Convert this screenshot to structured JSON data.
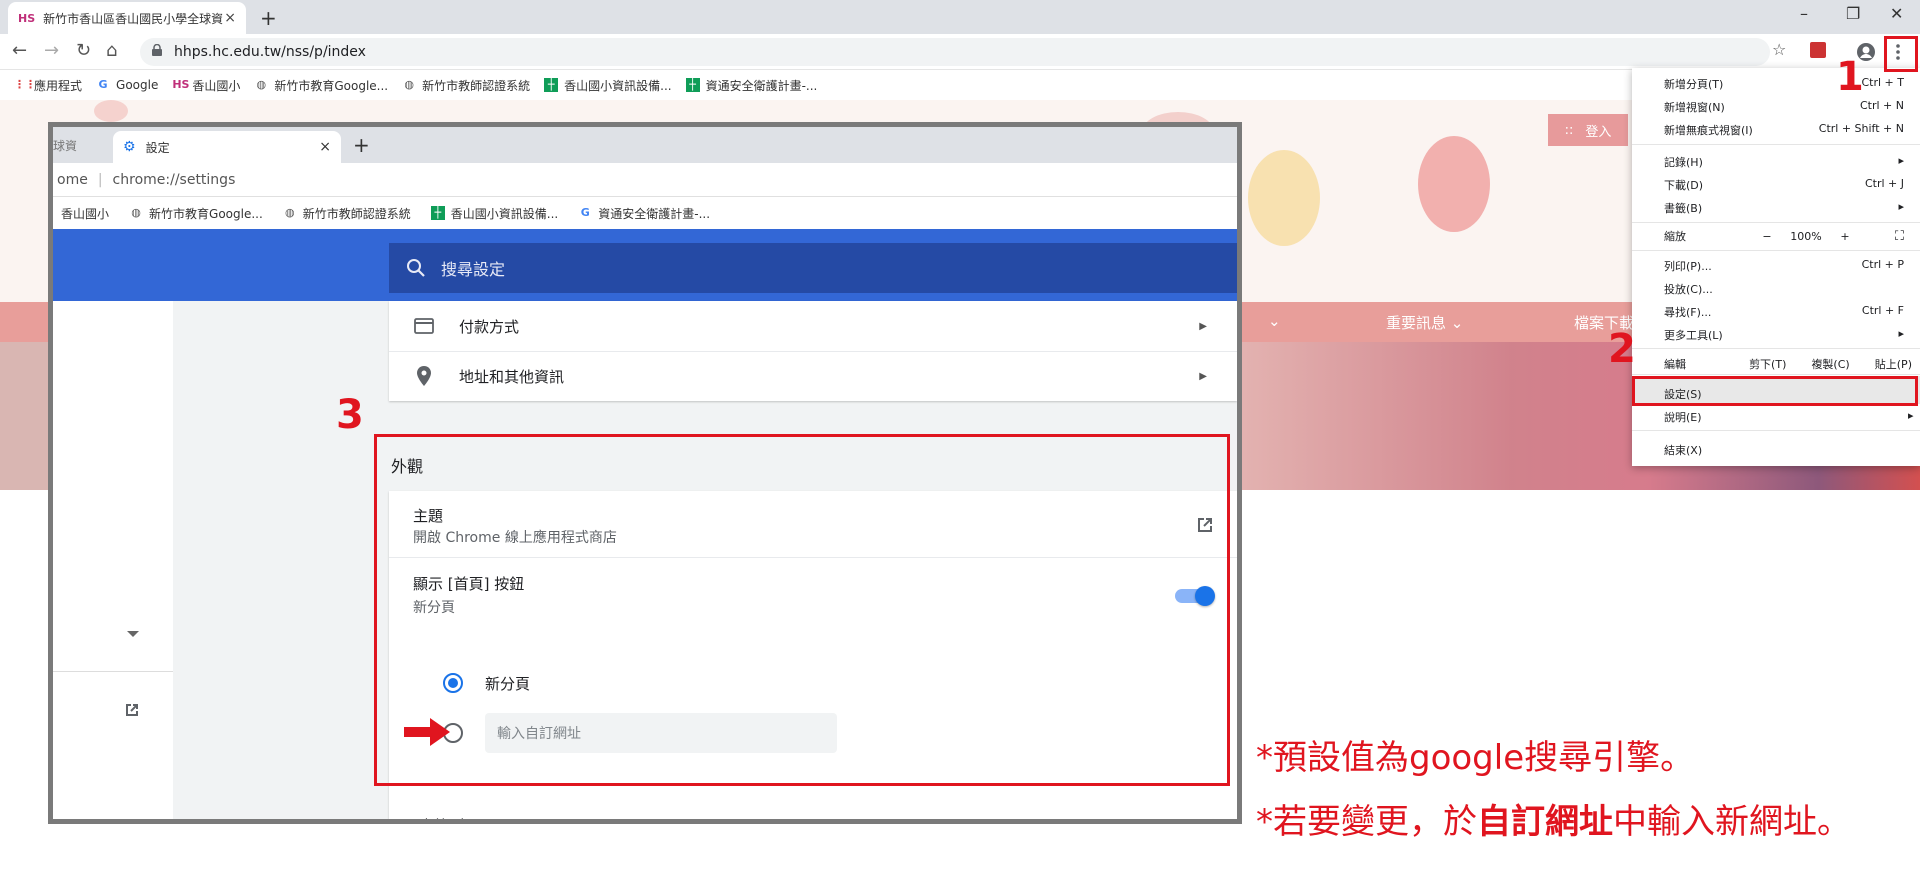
{
  "browser": {
    "tab": {
      "favicon": "HS",
      "title": "新竹市香山區香山國民小學全球資",
      "close": "×"
    },
    "new_tab": "+",
    "window_controls": [
      "–",
      "❐",
      "✕"
    ],
    "url": "hhps.hc.edu.tw/nss/p/index",
    "bookmarks": [
      {
        "icon": "apps-grid-icon",
        "label": "應用程式"
      },
      {
        "icon": "google-icon",
        "label": "Google"
      },
      {
        "icon": "hs-icon",
        "label": "香山國小"
      },
      {
        "icon": "globe-icon",
        "label": "新竹市教育Google..."
      },
      {
        "icon": "globe-icon",
        "label": "新竹市教師認證系統"
      },
      {
        "icon": "sheets-icon",
        "label": "香山國小資訊設備..."
      },
      {
        "icon": "sheets-icon",
        "label": "資通安全衛護計畫-..."
      }
    ]
  },
  "site": {
    "login_label": "登入",
    "login_prefix": "::",
    "nav": [
      "重要訊息 ⌄",
      "檔案下載"
    ],
    "nav_partial": "⌄"
  },
  "menu": {
    "items_top": [
      {
        "label": "新增分頁(T)",
        "shortcut": "Ctrl + T"
      },
      {
        "label": "新增視窗(N)",
        "shortcut": "Ctrl + N"
      },
      {
        "label": "新增無痕式視窗(I)",
        "shortcut": "Ctrl + Shift + N"
      }
    ],
    "items_mid": [
      {
        "label": "記錄(H)",
        "shortcut": "▸"
      },
      {
        "label": "下載(D)",
        "shortcut": "Ctrl + J"
      },
      {
        "label": "書籤(B)",
        "shortcut": "▸"
      }
    ],
    "zoom": {
      "label": "縮放",
      "minus": "−",
      "value": "100%",
      "plus": "+",
      "full": "⛶"
    },
    "items_tools": [
      {
        "label": "列印(P)...",
        "shortcut": "Ctrl + P"
      },
      {
        "label": "投放(C)...",
        "shortcut": ""
      },
      {
        "label": "尋找(F)...",
        "shortcut": "Ctrl + F"
      },
      {
        "label": "更多工具(L)",
        "shortcut": "▸"
      }
    ],
    "edit": {
      "label": "編輯",
      "cut": "剪下(T)",
      "copy": "複製(C)",
      "paste": "貼上(P)"
    },
    "settings": "設定(S)",
    "help": {
      "label": "說明(E)",
      "shortcut": "▸"
    },
    "exit": "結束(X)"
  },
  "inner": {
    "tab_fragment": "球資",
    "tab_title": "設定",
    "tab_close": "×",
    "new_tab": "+",
    "omni_left": "ome",
    "omni_url": "chrome://settings",
    "bookmarks": [
      {
        "icon": "hs-icon",
        "label": "香山國小"
      },
      {
        "icon": "globe-icon",
        "label": "新竹市教育Google..."
      },
      {
        "icon": "globe-icon",
        "label": "新竹市教師認證系統"
      },
      {
        "icon": "sheets-icon",
        "label": "香山國小資訊設備..."
      },
      {
        "icon": "google-icon",
        "label": "資通安全衛護計畫-..."
      }
    ],
    "search_placeholder": "搜尋設定",
    "autofill_rows": [
      {
        "icon": "credit-card-icon",
        "label": "付款方式"
      },
      {
        "icon": "location-pin-icon",
        "label": "地址和其他資訊"
      }
    ],
    "appearance": {
      "section_title": "外觀",
      "theme_title": "主題",
      "theme_sub": "開啟 Chrome 線上應用程式商店",
      "home_title": "顯示 [首頁] 按鈕",
      "home_sub": "新分頁",
      "home_toggle_on": true,
      "radio_newtab": "新分頁",
      "custom_url_placeholder": "輸入自訂網址",
      "next_partial": "顯示書籤列"
    }
  },
  "annotations": {
    "step1": "1",
    "step2": "2",
    "step3": "3",
    "note1": "*預設值為google搜尋引擎。",
    "note2_pre": "*若要變更，於",
    "note2_bold": "自訂網址",
    "note2_post": "中輸入新網址。",
    "red": "#e0151f"
  }
}
